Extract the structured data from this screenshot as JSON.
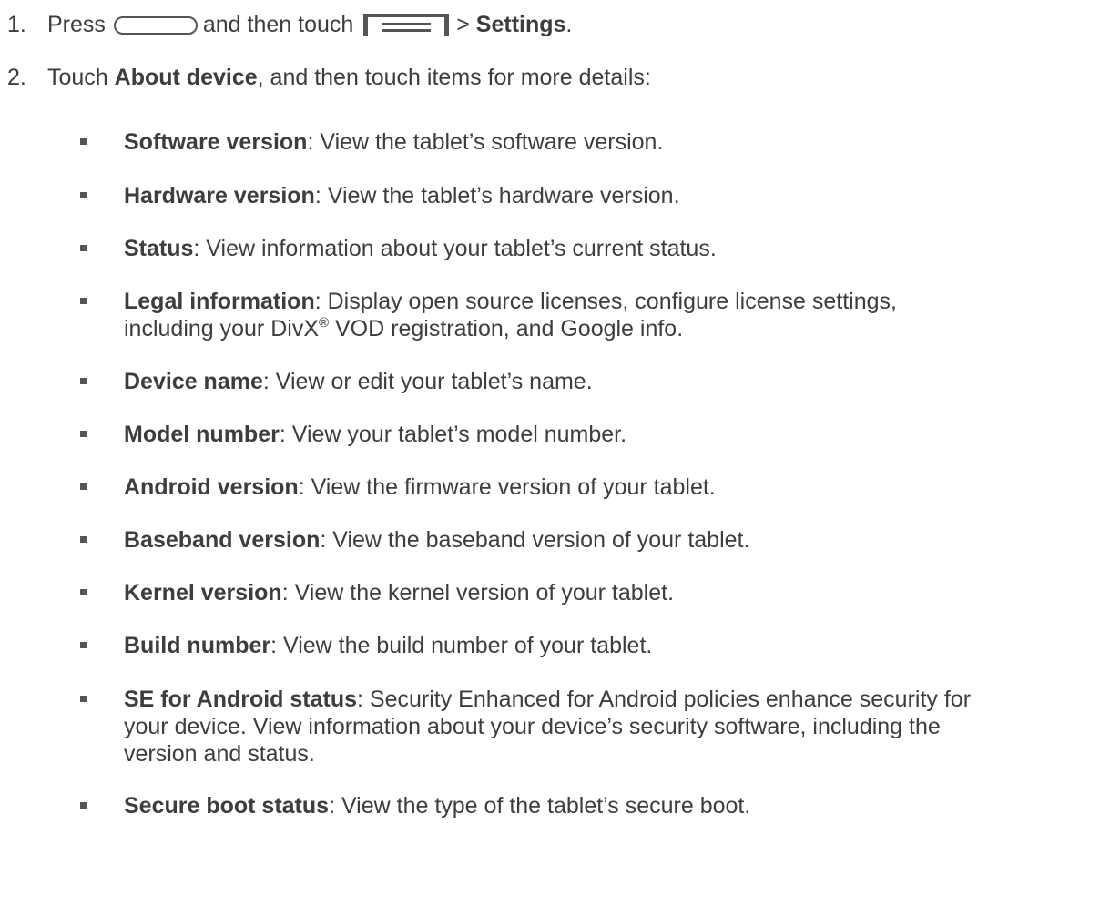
{
  "steps": [
    {
      "number": "1.",
      "press": "Press",
      "and_then_touch": "and then touch",
      "separator": ">",
      "settings": "Settings",
      "period": ".",
      "home_key_icon": "home-key-icon",
      "menu_key_icon": "menu-key-icon"
    },
    {
      "number": "2.",
      "touch": "Touch",
      "about_device": "About device",
      "rest": ", and then touch items for more details:"
    }
  ],
  "items": [
    {
      "label": "Software version",
      "text": ": View the tablet’s software version."
    },
    {
      "label": "Hardware version",
      "text": ": View the tablet’s hardware version."
    },
    {
      "label": "Status",
      "text": ": View information about your tablet’s current status."
    },
    {
      "label": "Legal information",
      "text_a": ": Display open source licenses, configure license settings,",
      "text_b": "including your DivX",
      "sup": "®",
      "text_c": " VOD registration, and Google info."
    },
    {
      "label": "Device name",
      "text": ": View or edit your tablet’s name."
    },
    {
      "label": "Model number",
      "text": ": View your tablet’s model number."
    },
    {
      "label": "Android version",
      "text": ": View the firmware version of your tablet."
    },
    {
      "label": "Baseband version",
      "text": ": View the baseband version of your tablet."
    },
    {
      "label": "Kernel version",
      "text": ": View the kernel version of your tablet."
    },
    {
      "label": "Build number",
      "text": ": View the build number of your tablet."
    },
    {
      "label": "SE for Android status",
      "text_a": ":  Security Enhanced for Android policies enhance security for",
      "text_b": "your device. View information about your device’s security software, including the",
      "text_c": "version and status."
    },
    {
      "label": "Secure boot status",
      "text": ": View the type of the tablet’s secure boot."
    }
  ]
}
